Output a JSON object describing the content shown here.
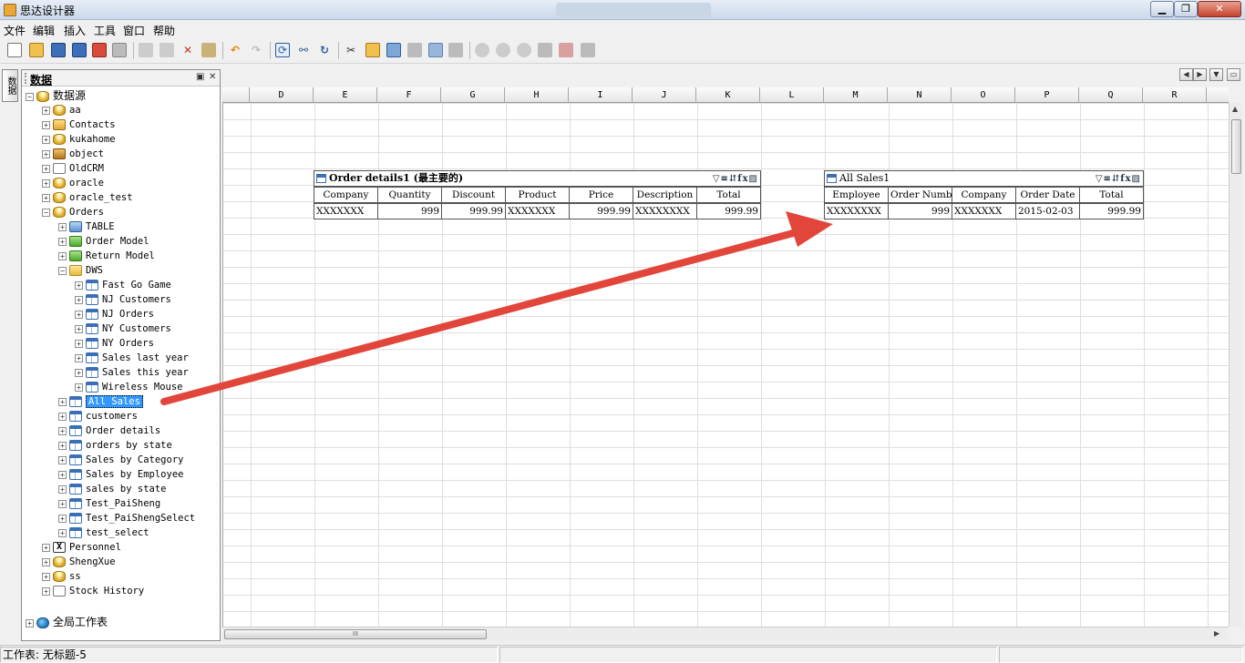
{
  "window": {
    "title": "思达设计器"
  },
  "menu": [
    "文件",
    "编辑",
    "插入",
    "工具",
    "窗口",
    "帮助"
  ],
  "side_tab": "数据",
  "panel": {
    "title": "数据",
    "pin_label": "▣",
    "close_label": "✕",
    "tree": [
      {
        "label": "数据源",
        "icon": "database-icon",
        "expander": "−"
      },
      {
        "label": "aa",
        "icon": "database-icon",
        "expander": "+"
      },
      {
        "label": "Contacts",
        "icon": "contacts-icon",
        "expander": "+"
      },
      {
        "label": "kukahome",
        "icon": "database-icon",
        "expander": "+"
      },
      {
        "label": "object",
        "icon": "object-icon",
        "expander": "+"
      },
      {
        "label": "OldCRM",
        "icon": "crm-icon",
        "expander": "+"
      },
      {
        "label": "oracle",
        "icon": "database-icon",
        "expander": "+"
      },
      {
        "label": "oracle_test",
        "icon": "database-icon",
        "expander": "+"
      },
      {
        "label": "Orders",
        "icon": "database-icon",
        "expander": "−"
      },
      {
        "label": "TABLE",
        "icon": "blue-folder-icon",
        "expander": "+"
      },
      {
        "label": "Order Model",
        "icon": "green-folder-icon",
        "expander": "+"
      },
      {
        "label": "Return Model",
        "icon": "green-folder-icon",
        "expander": "+"
      },
      {
        "label": "DWS",
        "icon": "folder-icon",
        "expander": "−"
      },
      {
        "label": "Fast Go Game",
        "icon": "table-icon",
        "expander": "+"
      },
      {
        "label": "NJ Customers",
        "icon": "table-icon",
        "expander": "+"
      },
      {
        "label": "NJ Orders",
        "icon": "table-icon",
        "expander": "+"
      },
      {
        "label": "NY Customers",
        "icon": "table-icon",
        "expander": "+"
      },
      {
        "label": "NY Orders",
        "icon": "table-icon",
        "expander": "+"
      },
      {
        "label": "Sales last year",
        "icon": "table-icon",
        "expander": "+"
      },
      {
        "label": "Sales this year",
        "icon": "table-icon",
        "expander": "+"
      },
      {
        "label": "Wireless Mouse",
        "icon": "table-icon",
        "expander": "+"
      },
      {
        "label": "All Sales",
        "icon": "table-icon",
        "expander": "+",
        "selected": true
      },
      {
        "label": "customers",
        "icon": "table-icon",
        "expander": "+"
      },
      {
        "label": "Order details",
        "icon": "table-icon",
        "expander": "+"
      },
      {
        "label": "orders by state",
        "icon": "table-icon",
        "expander": "+"
      },
      {
        "label": "Sales by Category",
        "icon": "table-icon",
        "expander": "+"
      },
      {
        "label": "Sales by Employee",
        "icon": "table-icon",
        "expander": "+"
      },
      {
        "label": "sales by state",
        "icon": "table-icon",
        "expander": "+"
      },
      {
        "label": "Test_PaiSheng",
        "icon": "table-icon",
        "expander": "+"
      },
      {
        "label": "Test_PaiShengSelect",
        "icon": "table-icon",
        "expander": "+"
      },
      {
        "label": "test_select",
        "icon": "table-icon",
        "expander": "+"
      },
      {
        "label": "Personnel",
        "icon": "excel-icon",
        "expander": "+"
      },
      {
        "label": "ShengXue",
        "icon": "database-icon",
        "expander": "+"
      },
      {
        "label": "ss",
        "icon": "database-icon",
        "expander": "+"
      },
      {
        "label": "Stock History",
        "icon": "crm-icon",
        "expander": "+"
      },
      {
        "label": "全局工作表",
        "icon": "globe-icon",
        "expander": "+"
      }
    ]
  },
  "columns": [
    "D",
    "E",
    "F",
    "G",
    "H",
    "I",
    "J",
    "K",
    "L",
    "M",
    "N",
    "O",
    "P",
    "Q",
    "R"
  ],
  "table1": {
    "title": "Order details1 (最主要的)",
    "headers": [
      "Company",
      "Quantity",
      "Discount",
      "Product",
      "Price",
      "Description",
      "Total"
    ],
    "row": [
      "XXXXXXX",
      "999",
      "999.99",
      "XXXXXXX",
      "999.99",
      "XXXXXXXX",
      "999.99"
    ]
  },
  "table2": {
    "title": "All Sales1",
    "headers": [
      "Employee",
      "Order Number",
      "Company",
      "Order Date",
      "Total"
    ],
    "row": [
      "XXXXXXXX",
      "999",
      "XXXXXXX",
      "2015-02-03",
      "999.99"
    ]
  },
  "table_tools": "▽≡⇵fx▨",
  "hscroll_grip": "III",
  "status": {
    "worksheet": "工作表: 无标题-5"
  },
  "colors": {
    "arrow": "#e2463b",
    "selection": "#3399ff"
  }
}
